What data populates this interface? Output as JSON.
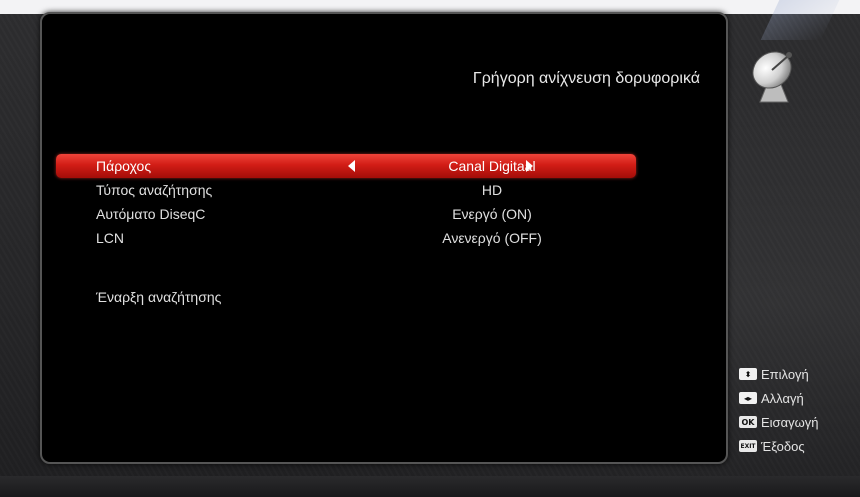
{
  "header": {
    "title": "Γρήγορη ανίχνευση δορυφορικά"
  },
  "menu": {
    "rows": [
      {
        "label": "Πάροχος",
        "value": "Canal Digitaal"
      },
      {
        "label": "Τύπος αναζήτησης",
        "value": "HD"
      },
      {
        "label": "Αυτόματο DiseqC",
        "value": "Ενεργό (ON)"
      },
      {
        "label": "LCN",
        "value": "Ανενεργό (OFF)"
      }
    ],
    "start_scan": "Έναρξη αναζήτησης"
  },
  "help": {
    "items": [
      {
        "key": "⬍",
        "label": "Επιλογή",
        "icon": "up-down-key-icon"
      },
      {
        "key": "◂▸",
        "label": "Αλλαγή",
        "icon": "left-right-key-icon"
      },
      {
        "key": "OK",
        "label": "Εισαγωγή",
        "icon": "ok-key-icon"
      },
      {
        "key": "EXIT",
        "label": "Έξοδος",
        "icon": "exit-key-icon"
      }
    ]
  },
  "colors": {
    "selected_row": "#d21d16",
    "panel_bg": "#000000"
  }
}
